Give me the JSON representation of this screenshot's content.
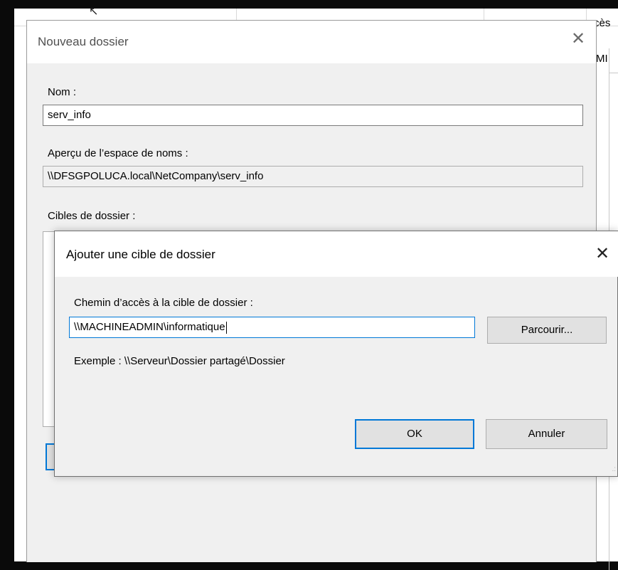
{
  "background_window": {
    "header_partial_text": "cès",
    "cell_partial_text": "MI"
  },
  "new_folder_dialog": {
    "title": "Nouveau dossier",
    "close_glyph": "✕",
    "name_label": "Nom :",
    "name_value": "serv_info",
    "namespace_preview_label": "Aperçu de l’espace de noms :",
    "namespace_preview_value": "\\\\DFSGPOLUCA.local\\NetCompany\\serv_info",
    "folder_targets_label": "Cibles de dossier :"
  },
  "add_target_dialog": {
    "title": "Ajouter une cible de dossier",
    "close_glyph": "✕",
    "path_label": "Chemin d’accès à la cible de dossier :",
    "path_value": "\\\\MACHINEADMIN\\informatique",
    "browse_button": "Parcourir...",
    "example_text": "Exemple : \\\\Serveur\\Dossier partagé\\Dossier",
    "ok_button": "OK",
    "cancel_button": "Annuler"
  },
  "colors": {
    "accent": "#0078d7",
    "dialog_bg": "#f0f0f0",
    "desktop_bg": "#0a0a0a"
  }
}
